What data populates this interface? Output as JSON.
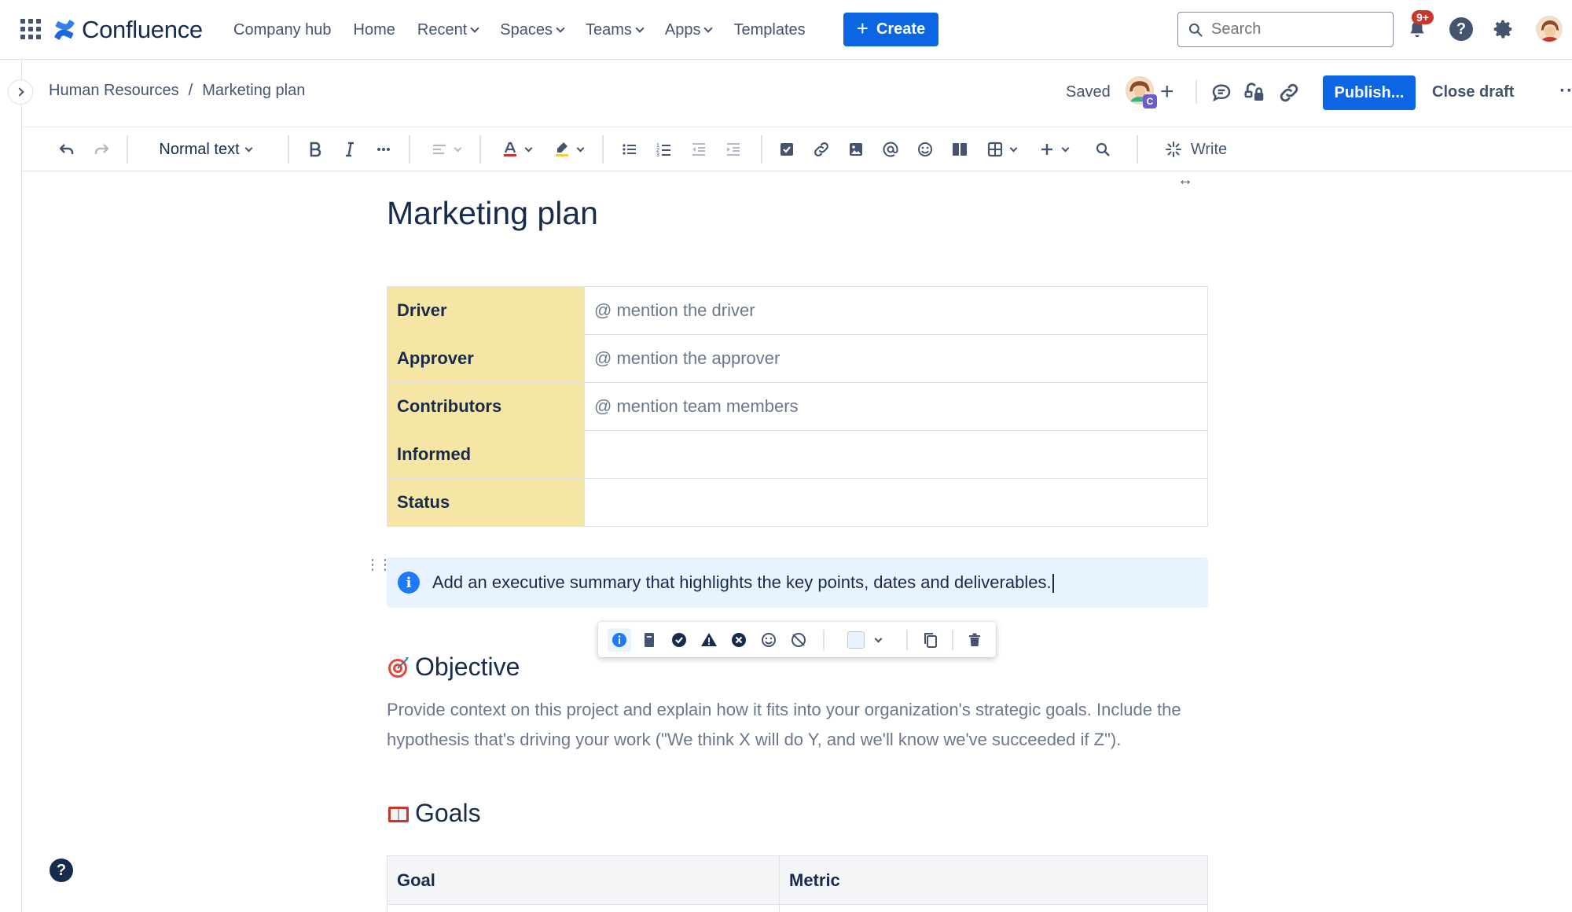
{
  "app": {
    "name": "Confluence"
  },
  "nav": {
    "items": [
      {
        "label": "Company hub",
        "dropdown": false
      },
      {
        "label": "Home",
        "dropdown": false
      },
      {
        "label": "Recent",
        "dropdown": true
      },
      {
        "label": "Spaces",
        "dropdown": true
      },
      {
        "label": "Teams",
        "dropdown": true
      },
      {
        "label": "Apps",
        "dropdown": true
      },
      {
        "label": "Templates",
        "dropdown": false
      }
    ],
    "create_label": "Create",
    "search_placeholder": "Search",
    "notifications_badge": "9+"
  },
  "breadcrumb": {
    "space": "Human Resources",
    "page": "Marketing plan"
  },
  "draft": {
    "status": "Saved",
    "collaborator_badge": "C",
    "publish_label": "Publish...",
    "close_label": "Close draft"
  },
  "toolbar": {
    "text_style": "Normal text",
    "write_label": "Write"
  },
  "page": {
    "title": "Marketing plan",
    "meta_table": [
      {
        "key": "Driver",
        "value": "@ mention the driver"
      },
      {
        "key": "Approver",
        "value": "@ mention the approver"
      },
      {
        "key": "Contributors",
        "value": "@ mention team members"
      },
      {
        "key": "Informed",
        "value": ""
      },
      {
        "key": "Status",
        "value": ""
      }
    ],
    "info_panel": "Add an executive summary that highlights the key points, dates and deliverables.",
    "objective": {
      "heading": "Objective",
      "body": "Provide context on this project and explain how it fits into your organization's strategic goals. Include the hypothesis that's driving your work (\"We think X will do Y, and we'll know we've succeeded if Z\")."
    },
    "goals": {
      "heading": "Goals",
      "columns": [
        "Goal",
        "Metric"
      ]
    }
  },
  "colors": {
    "brand_blue": "#0c66e4",
    "info_panel_bg": "#e9f2ff",
    "table_header_yellow": "#f6e6a6",
    "notification_red": "#c9372c"
  }
}
